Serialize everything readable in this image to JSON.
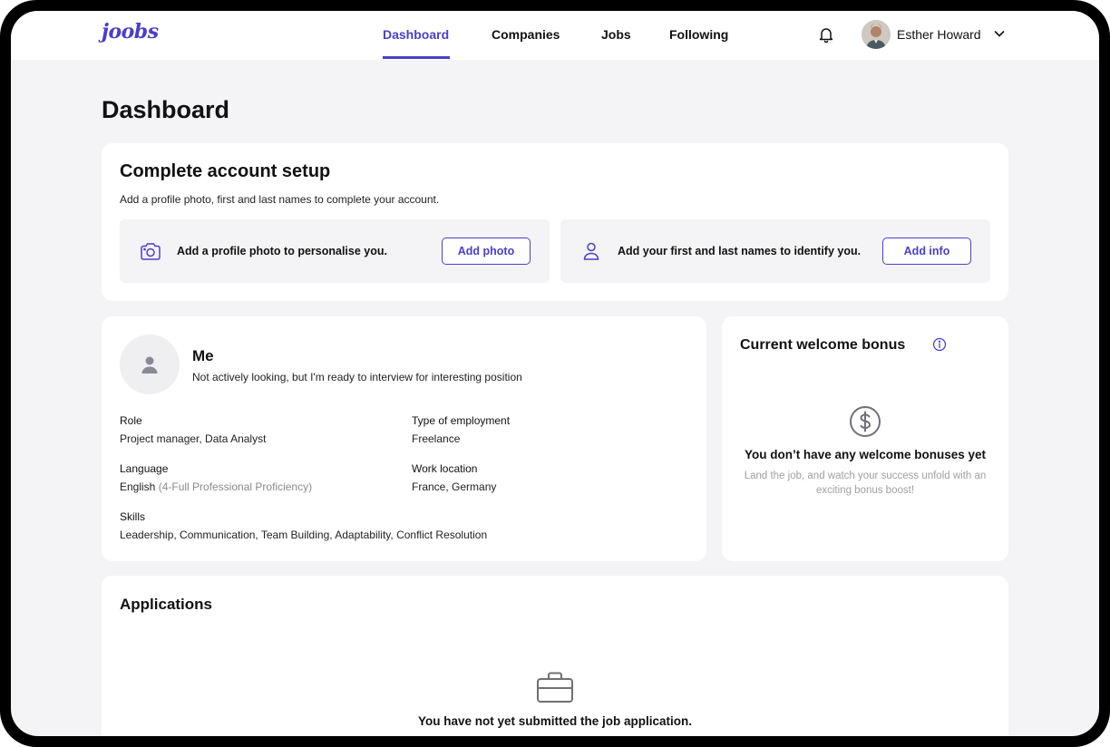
{
  "header": {
    "logo": "joobs",
    "nav": [
      {
        "label": "Dashboard",
        "active": true
      },
      {
        "label": "Companies",
        "active": false
      },
      {
        "label": "Jobs",
        "active": false
      },
      {
        "label": "Following",
        "active": false
      }
    ],
    "user_name": "Esther Howard",
    "icons": {
      "notifications": "bell-icon",
      "user_menu": "chevron-down-icon"
    }
  },
  "page_title": "Dashboard",
  "setup": {
    "title": "Complete account setup",
    "subtitle": "Add a profile photo, first and last names to complete your account.",
    "photo_task": {
      "text": "Add a profile photo to personalise you.",
      "button": "Add photo",
      "icon": "camera-icon"
    },
    "info_task": {
      "text": "Add your first and last names to identify you.",
      "button": "Add info",
      "icon": "user-icon"
    }
  },
  "profile": {
    "name": "Me",
    "status": "Not actively looking, but I'm ready to interview for interesting position",
    "role_label": "Role",
    "role_value": "Project manager, Data Analyst",
    "employment_label": "Type of employment",
    "employment_value": "Freelance",
    "language_label": "Language",
    "language_value": "English",
    "language_level": "(4-Full Professional Proficiency)",
    "location_label": "Work location",
    "location_value": "France, Germany",
    "skills_label": "Skills",
    "skills_value": "Leadership, Communication, Team Building, Adaptability, Conflict Resolution"
  },
  "bonus": {
    "title": "Current welcome bonus",
    "empty_title": "You don’t have any welcome bonuses yet",
    "empty_sub": "Land the job, and watch your success unfold with an exciting bonus boost!"
  },
  "applications": {
    "title": "Applications",
    "empty_text": "You have not yet submitted the job application."
  },
  "colors": {
    "accent": "#4a3fc9",
    "background": "#f4f4f6",
    "muted": "#a0a0a6"
  }
}
